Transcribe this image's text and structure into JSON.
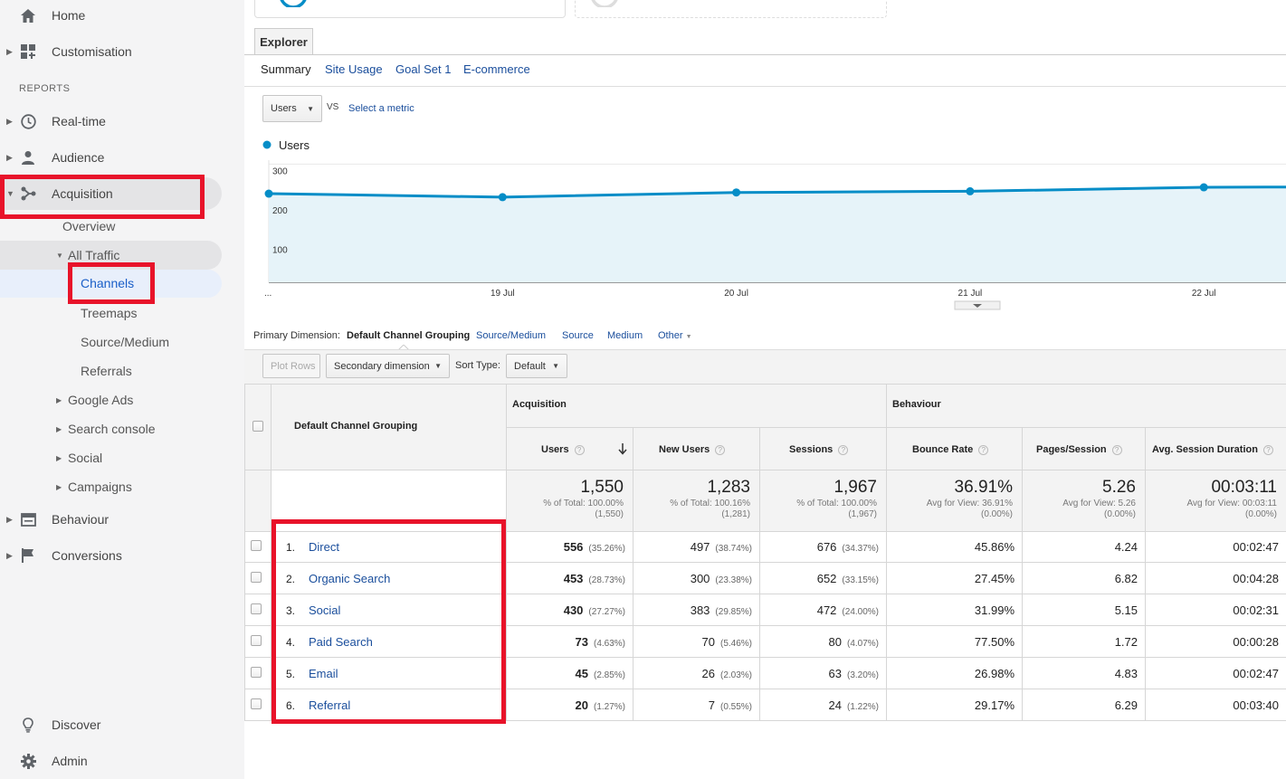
{
  "sidebar": {
    "home": "Home",
    "customisation": "Customisation",
    "reports_header": "REPORTS",
    "realtime": "Real-time",
    "audience": "Audience",
    "acquisition": "Acquisition",
    "overview": "Overview",
    "all_traffic": "All Traffic",
    "channels": "Channels",
    "treemaps": "Treemaps",
    "source_medium": "Source/Medium",
    "referrals": "Referrals",
    "google_ads": "Google Ads",
    "search_console": "Search console",
    "social": "Social",
    "campaigns": "Campaigns",
    "behaviour": "Behaviour",
    "conversions": "Conversions",
    "discover": "Discover",
    "admin": "Admin"
  },
  "tabs": {
    "explorer": "Explorer",
    "subtabs": [
      "Summary",
      "Site Usage",
      "Goal Set 1",
      "E-commerce"
    ]
  },
  "metric": {
    "selected": "Users",
    "vs": "VS",
    "select_metric": "Select a metric"
  },
  "chart_data": {
    "type": "line",
    "series": [
      {
        "name": "Users",
        "values": [
          225,
          216,
          228,
          231,
          241,
          243
        ]
      }
    ],
    "x": [
      "...",
      "19 Jul",
      "20 Jul",
      "21 Jul",
      "22 Jul",
      ""
    ],
    "yticks": [
      300,
      200,
      100
    ],
    "ylim": [
      0,
      310
    ],
    "color": "#058dc7",
    "fill": "#e6f3f9"
  },
  "dimension": {
    "label": "Primary Dimension:",
    "active": "Default Channel Grouping",
    "links": [
      "Source/Medium",
      "Source",
      "Medium",
      "Other"
    ]
  },
  "toolbar": {
    "plot_rows": "Plot Rows",
    "secondary_dimension": "Secondary dimension",
    "sort_type_label": "Sort Type:",
    "sort_type_value": "Default"
  },
  "table": {
    "dimension_header": "Default Channel Grouping",
    "group_acquisition": "Acquisition",
    "group_behaviour": "Behaviour",
    "columns": [
      "Users",
      "New Users",
      "Sessions",
      "Bounce Rate",
      "Pages/Session",
      "Avg. Session Duration"
    ],
    "totals": [
      {
        "big": "1,550",
        "l1": "% of Total: 100.00%",
        "l2": "(1,550)"
      },
      {
        "big": "1,283",
        "l1": "% of Total: 100.16%",
        "l2": "(1,281)"
      },
      {
        "big": "1,967",
        "l1": "% of Total: 100.00%",
        "l2": "(1,967)"
      },
      {
        "big": "36.91%",
        "l1": "Avg for View: 36.91%",
        "l2": "(0.00%)"
      },
      {
        "big": "5.26",
        "l1": "Avg for View: 5.26",
        "l2": "(0.00%)"
      },
      {
        "big": "00:03:11",
        "l1": "Avg for View: 00:03:11",
        "l2": "(0.00%)"
      }
    ],
    "rows": [
      {
        "num": "1.",
        "channel": "Direct",
        "users": "556",
        "users_pct": "(35.26%)",
        "new_users": "497",
        "new_users_pct": "(38.74%)",
        "sessions": "676",
        "sessions_pct": "(34.37%)",
        "bounce": "45.86%",
        "pages": "4.24",
        "duration": "00:02:47"
      },
      {
        "num": "2.",
        "channel": "Organic Search",
        "users": "453",
        "users_pct": "(28.73%)",
        "new_users": "300",
        "new_users_pct": "(23.38%)",
        "sessions": "652",
        "sessions_pct": "(33.15%)",
        "bounce": "27.45%",
        "pages": "6.82",
        "duration": "00:04:28"
      },
      {
        "num": "3.",
        "channel": "Social",
        "users": "430",
        "users_pct": "(27.27%)",
        "new_users": "383",
        "new_users_pct": "(29.85%)",
        "sessions": "472",
        "sessions_pct": "(24.00%)",
        "bounce": "31.99%",
        "pages": "5.15",
        "duration": "00:02:31"
      },
      {
        "num": "4.",
        "channel": "Paid Search",
        "users": "73",
        "users_pct": "(4.63%)",
        "new_users": "70",
        "new_users_pct": "(5.46%)",
        "sessions": "80",
        "sessions_pct": "(4.07%)",
        "bounce": "77.50%",
        "pages": "1.72",
        "duration": "00:00:28"
      },
      {
        "num": "5.",
        "channel": "Email",
        "users": "45",
        "users_pct": "(2.85%)",
        "new_users": "26",
        "new_users_pct": "(2.03%)",
        "sessions": "63",
        "sessions_pct": "(3.20%)",
        "bounce": "26.98%",
        "pages": "4.83",
        "duration": "00:02:47"
      },
      {
        "num": "6.",
        "channel": "Referral",
        "users": "20",
        "users_pct": "(1.27%)",
        "new_users": "7",
        "new_users_pct": "(0.55%)",
        "sessions": "24",
        "sessions_pct": "(1.22%)",
        "bounce": "29.17%",
        "pages": "6.29",
        "duration": "00:03:40"
      }
    ]
  }
}
